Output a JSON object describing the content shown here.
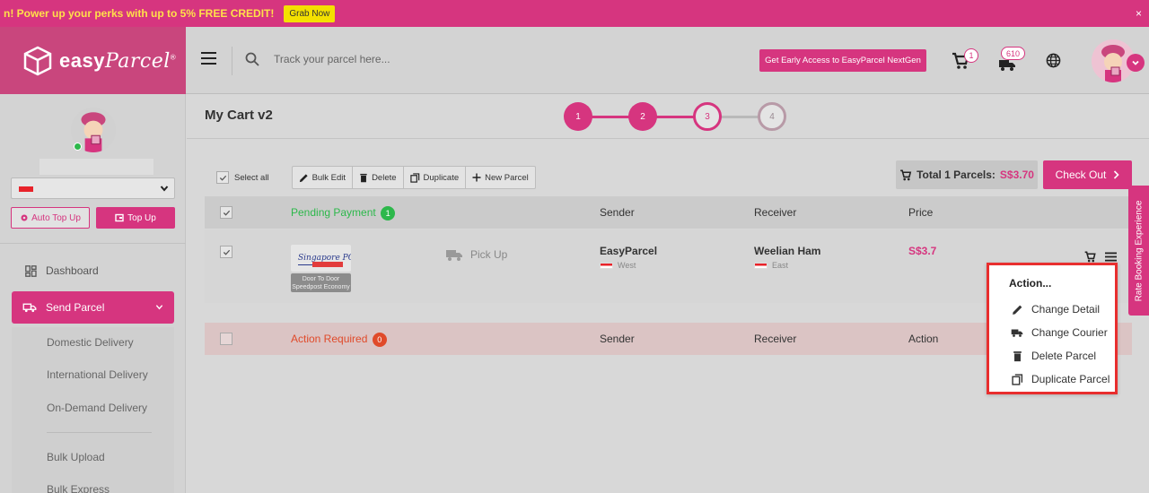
{
  "promo": {
    "text": "n! Power up your perks with up to 5% FREE CREDIT!",
    "button": "Grab Now",
    "close": "×"
  },
  "header": {
    "logo_text": "easy",
    "logo_script": "Parcel",
    "logo_reg": "®",
    "search_placeholder": "Track your parcel here...",
    "nextgen_button": "Get Early Access to EasyParcel NextGen",
    "cart_count": "1",
    "shipment_count": "610"
  },
  "sidebar": {
    "auto_topup": "Auto Top Up",
    "topup": "Top Up",
    "nav": {
      "dashboard": "Dashboard",
      "send_parcel": "Send Parcel",
      "sub_items": [
        "Domestic Delivery",
        "International Delivery",
        "On-Demand Delivery",
        "Bulk Upload",
        "Bulk Express"
      ]
    }
  },
  "main": {
    "title": "My Cart v2",
    "steps": [
      "1",
      "2",
      "3",
      "4"
    ],
    "toolbar": {
      "select_all": "Select all",
      "bulk_edit": "Bulk Edit",
      "delete": "Delete",
      "duplicate": "Duplicate",
      "new_parcel": "New Parcel"
    },
    "total_label": "Total 1 Parcels:",
    "total_value": "S$3.70",
    "checkout": "Check Out",
    "pending": {
      "label": "Pending Payment",
      "count": "1",
      "col_sender": "Sender",
      "col_receiver": "Receiver",
      "col_price": "Price"
    },
    "row": {
      "courier_logo": "Singapore POST",
      "courier_service": "Door To Door Speedpost Economy",
      "pickup": "Pick Up",
      "sender_name": "EasyParcel",
      "sender_region": "West",
      "receiver_name": "Weelian Ham",
      "receiver_region": "East",
      "price": "S$3.7"
    },
    "action_required": {
      "label": "Action Required",
      "count": "0",
      "col_sender": "Sender",
      "col_receiver": "Receiver",
      "col_action": "Action"
    }
  },
  "rate_tab": "Rate Booking Experience",
  "action_menu": {
    "title": "Action...",
    "items": [
      "Change Detail",
      "Change Courier",
      "Delete Parcel",
      "Duplicate Parcel"
    ]
  },
  "colors": {
    "brand": "#d6357f",
    "promo_text": "#ffe04a",
    "success": "#2db84b",
    "danger": "#e04a2a",
    "highlight": "#e82e2e"
  }
}
